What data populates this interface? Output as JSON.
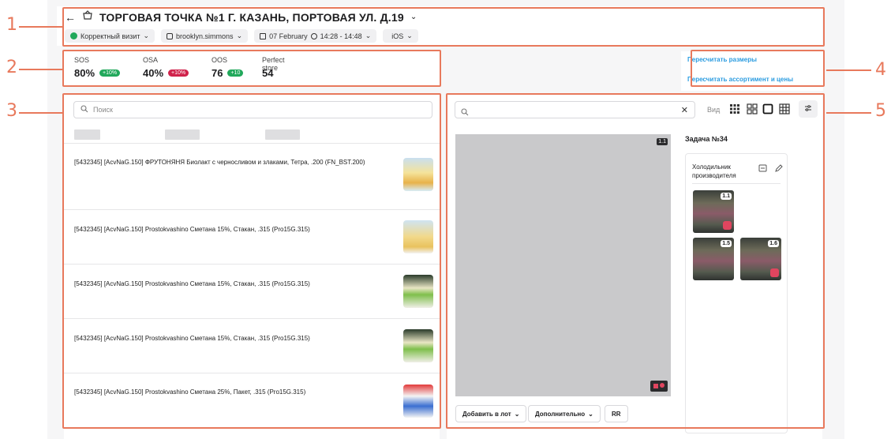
{
  "header": {
    "title": "ТОРГОВАЯ ТОЧКА №1 Г. КАЗАНЬ, ПОРТОВАЯ УЛ. Д.19",
    "chips": [
      {
        "label": "Корректный визит"
      },
      {
        "label": "brooklyn.simmons"
      },
      {
        "label": "07 February"
      },
      {
        "label": "14:28 - 14:48"
      },
      {
        "label": "iOS"
      }
    ]
  },
  "metrics": [
    {
      "label": "SOS",
      "value": "80%",
      "badge": "+10%",
      "badge_color": "#21a85b"
    },
    {
      "label": "OSA",
      "value": "40%",
      "badge": "+10%",
      "badge_color": "#d0224b"
    },
    {
      "label": "OOS",
      "value": "76",
      "badge": "+10",
      "badge_color": "#21a85b"
    },
    {
      "label": "Perfect store",
      "value": "54"
    }
  ],
  "actions": {
    "recalc_sizes": "Пересчитать размеры",
    "recalc_assortment": "Пересчитать ассортимент и цены"
  },
  "left_panel": {
    "search_placeholder": "Поиск",
    "items": [
      {
        "text": "[5432345] [AcvNaG.150] ФРУТОНЯНЯ Биолакт с черносливом и злаками, Тетра, .200 (FN_BST.200)"
      },
      {
        "text": "[5432345] [AcvNaG.150] Prostokvashino Сметана 15%, Стакан, .315 (Pro15G.315)"
      },
      {
        "text": "[5432345] [AcvNaG.150] Prostokvashino Сметана 15%, Стакан, .315 (Pro15G.315)"
      },
      {
        "text": "[5432345] [AcvNaG.150] Prostokvashino Сметана 15%, Стакан, .315 (Pro15G.315)"
      },
      {
        "text": "[5432345] [AcvNaG.150] Prostokvashino Сметана 25%, Пакет, .315 (Pro15G.315)"
      }
    ]
  },
  "right_panel": {
    "view_label": "Вид",
    "image_tag": "1.1",
    "buttons": {
      "add_to_lot": "Добавить в лот",
      "additional": "Дополнительно",
      "rr": "RR"
    },
    "task": {
      "title": "Задача №34",
      "card_title": "Холодильник производителя",
      "photos": [
        {
          "tag": "1.1"
        },
        {
          "tag": "1.5"
        },
        {
          "tag": "1.6"
        }
      ]
    }
  },
  "callouts": [
    "1",
    "2",
    "3",
    "4",
    "5"
  ],
  "colors": {
    "annotation": "#e8795c",
    "link": "#2b9ce0",
    "badge_green": "#21a85b",
    "badge_red": "#d0224b"
  }
}
